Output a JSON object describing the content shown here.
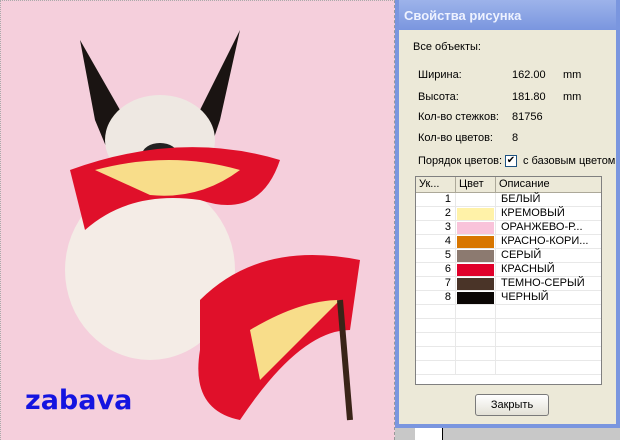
{
  "canvas": {
    "signature": "zabava"
  },
  "dialog": {
    "title": "Свойства рисунка",
    "section": "Все объекты:",
    "width_label": "Ширина:",
    "width_value": "162.00",
    "width_unit": "mm",
    "height_label": "Высота:",
    "height_value": "181.80",
    "height_unit": "mm",
    "stitches_label": "Кол-во стежков:",
    "stitches_value": "81756",
    "colors_label": "Кол-во цветов:",
    "colors_value": "8",
    "order_label": "Порядок цветов:",
    "order_checked": "✔",
    "order_option": "с базовым цветом",
    "columns": [
      "Ук...",
      "Цвет",
      "Описание"
    ],
    "rows": [
      {
        "n": "1",
        "color": "#ffffff",
        "desc": "БЕЛЫЙ"
      },
      {
        "n": "2",
        "color": "#fff2a8",
        "desc": "КРЕМОВЫЙ"
      },
      {
        "n": "3",
        "color": "#f9c3da",
        "desc": "ОРАНЖЕВО-Р..."
      },
      {
        "n": "4",
        "color": "#d87600",
        "desc": "КРАСНО-КОРИ..."
      },
      {
        "n": "5",
        "color": "#8c7a70",
        "desc": "СЕРЫЙ"
      },
      {
        "n": "6",
        "color": "#e0002a",
        "desc": "КРАСНЫЙ"
      },
      {
        "n": "7",
        "color": "#4a3428",
        "desc": "ТЕМНО-СЕРЫЙ"
      },
      {
        "n": "8",
        "color": "#0a0604",
        "desc": "ЧЕРНЫЙ"
      }
    ],
    "close_label": "Закрыть"
  }
}
